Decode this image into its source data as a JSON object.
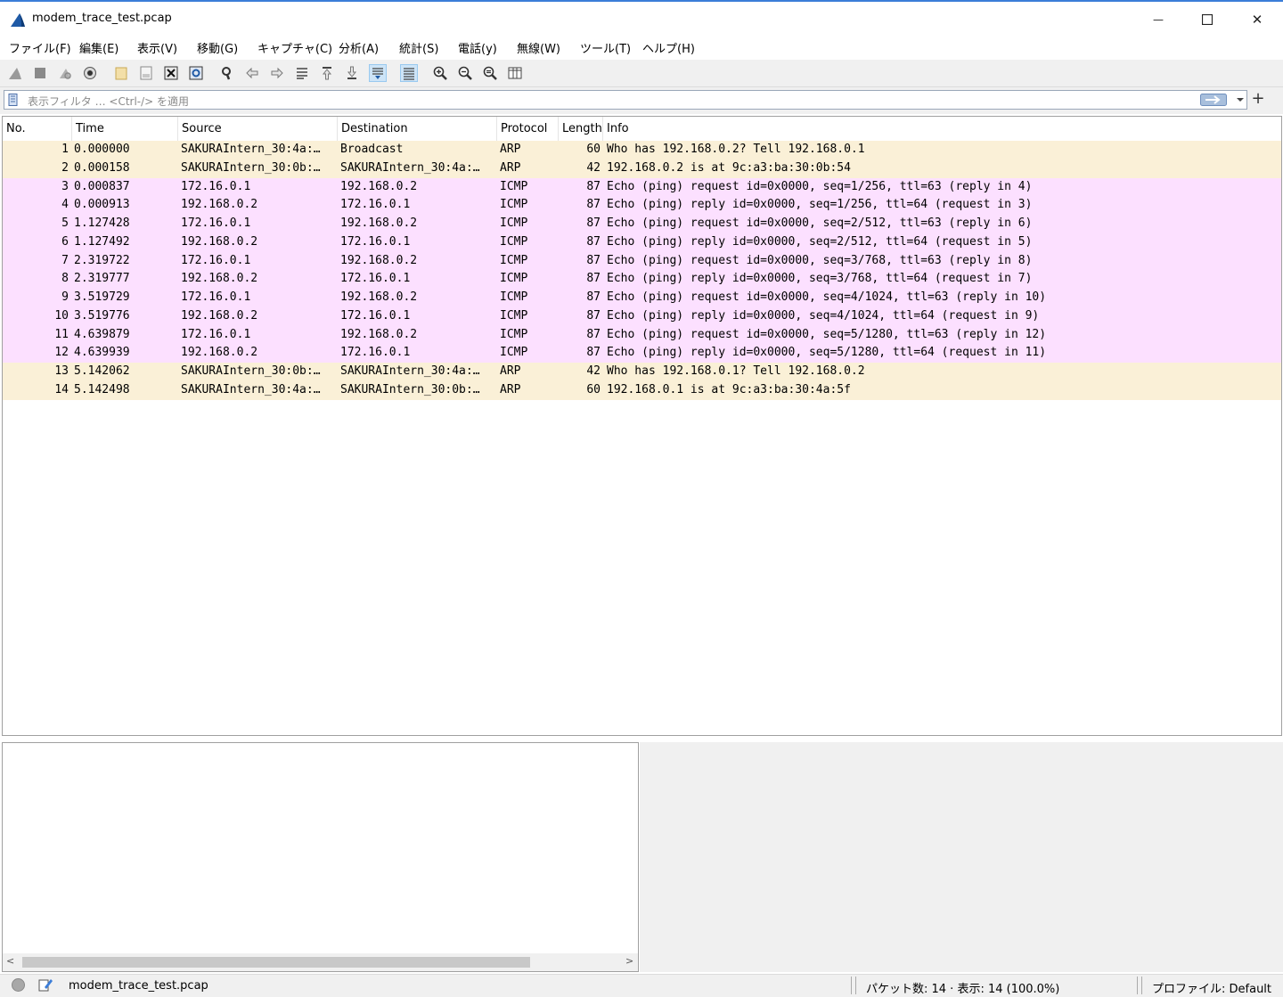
{
  "window": {
    "title": "modem_trace_test.pcap",
    "min_glyph": "—",
    "close_glyph": "✕"
  },
  "menu": {
    "items": [
      {
        "label": "ファイル(F)"
      },
      {
        "label": "編集(E)"
      },
      {
        "label": "表示(V)"
      },
      {
        "label": "移動(G)"
      },
      {
        "label": "キャプチャ(C)"
      },
      {
        "label": "分析(A)"
      },
      {
        "label": "統計(S)"
      },
      {
        "label": "電話(y)"
      },
      {
        "label": "無線(W)"
      },
      {
        "label": "ツール(T)"
      },
      {
        "label": "ヘルプ(H)"
      }
    ]
  },
  "toolbar": {
    "icons": [
      "shark-fin-start-icon",
      "stop-square-icon",
      "restart-icon",
      "capture-options-icon",
      "open-folder-icon",
      "save-file-icon",
      "close-file-icon",
      "reload-file-icon",
      "find-packet-icon",
      "go-back-icon",
      "go-forward-icon",
      "go-to-packet-icon",
      "first-packet-icon",
      "last-packet-icon",
      "autoscroll-icon",
      "colorize-icon",
      "zoom-in-icon",
      "zoom-out-icon",
      "zoom-normal-icon",
      "resize-columns-icon"
    ]
  },
  "filter": {
    "placeholder": "表示フィルタ … <Ctrl-/> を適用",
    "add_label": "+"
  },
  "packet_list": {
    "columns": [
      {
        "label": "No."
      },
      {
        "label": "Time"
      },
      {
        "label": "Source"
      },
      {
        "label": "Destination"
      },
      {
        "label": "Protocol"
      },
      {
        "label": "Length"
      },
      {
        "label": "Info"
      }
    ],
    "colors": {
      "arp": "#faf0d7",
      "icmp": "#fce0ff"
    },
    "rows": [
      {
        "no": "1",
        "time": "0.000000",
        "source": "SAKURAIntern_30:4a:…",
        "destination": "Broadcast",
        "protocol": "ARP",
        "length": "60",
        "info": "Who has 192.168.0.2? Tell 192.168.0.1"
      },
      {
        "no": "2",
        "time": "0.000158",
        "source": "SAKURAIntern_30:0b:…",
        "destination": "SAKURAIntern_30:4a:…",
        "protocol": "ARP",
        "length": "42",
        "info": "192.168.0.2 is at 9c:a3:ba:30:0b:54"
      },
      {
        "no": "3",
        "time": "0.000837",
        "source": "172.16.0.1",
        "destination": "192.168.0.2",
        "protocol": "ICMP",
        "length": "87",
        "info": "Echo (ping) request  id=0x0000, seq=1/256, ttl=63 (reply in 4)"
      },
      {
        "no": "4",
        "time": "0.000913",
        "source": "192.168.0.2",
        "destination": "172.16.0.1",
        "protocol": "ICMP",
        "length": "87",
        "info": "Echo (ping) reply    id=0x0000, seq=1/256, ttl=64 (request in 3)"
      },
      {
        "no": "5",
        "time": "1.127428",
        "source": "172.16.0.1",
        "destination": "192.168.0.2",
        "protocol": "ICMP",
        "length": "87",
        "info": "Echo (ping) request  id=0x0000, seq=2/512, ttl=63 (reply in 6)"
      },
      {
        "no": "6",
        "time": "1.127492",
        "source": "192.168.0.2",
        "destination": "172.16.0.1",
        "protocol": "ICMP",
        "length": "87",
        "info": "Echo (ping) reply    id=0x0000, seq=2/512, ttl=64 (request in 5)"
      },
      {
        "no": "7",
        "time": "2.319722",
        "source": "172.16.0.1",
        "destination": "192.168.0.2",
        "protocol": "ICMP",
        "length": "87",
        "info": "Echo (ping) request  id=0x0000, seq=3/768, ttl=63 (reply in 8)"
      },
      {
        "no": "8",
        "time": "2.319777",
        "source": "192.168.0.2",
        "destination": "172.16.0.1",
        "protocol": "ICMP",
        "length": "87",
        "info": "Echo (ping) reply    id=0x0000, seq=3/768, ttl=64 (request in 7)"
      },
      {
        "no": "9",
        "time": "3.519729",
        "source": "172.16.0.1",
        "destination": "192.168.0.2",
        "protocol": "ICMP",
        "length": "87",
        "info": "Echo (ping) request  id=0x0000, seq=4/1024, ttl=63 (reply in 10)"
      },
      {
        "no": "10",
        "time": "3.519776",
        "source": "192.168.0.2",
        "destination": "172.16.0.1",
        "protocol": "ICMP",
        "length": "87",
        "info": "Echo (ping) reply    id=0x0000, seq=4/1024, ttl=64 (request in 9)"
      },
      {
        "no": "11",
        "time": "4.639879",
        "source": "172.16.0.1",
        "destination": "192.168.0.2",
        "protocol": "ICMP",
        "length": "87",
        "info": "Echo (ping) request  id=0x0000, seq=5/1280, ttl=63 (reply in 12)"
      },
      {
        "no": "12",
        "time": "4.639939",
        "source": "192.168.0.2",
        "destination": "172.16.0.1",
        "protocol": "ICMP",
        "length": "87",
        "info": "Echo (ping) reply    id=0x0000, seq=5/1280, ttl=64 (request in 11)"
      },
      {
        "no": "13",
        "time": "5.142062",
        "source": "SAKURAIntern_30:0b:…",
        "destination": "SAKURAIntern_30:4a:…",
        "protocol": "ARP",
        "length": "42",
        "info": "Who has 192.168.0.1? Tell 192.168.0.2"
      },
      {
        "no": "14",
        "time": "5.142498",
        "source": "SAKURAIntern_30:4a:…",
        "destination": "SAKURAIntern_30:0b:…",
        "protocol": "ARP",
        "length": "60",
        "info": "192.168.0.1 is at 9c:a3:ba:30:4a:5f"
      }
    ]
  },
  "details": {
    "scroll_left": "<",
    "scroll_right": ">"
  },
  "status": {
    "file": "modem_trace_test.pcap",
    "packets": "パケット数: 14 · 表示: 14 (100.0%)",
    "profile": "プロファイル: Default"
  }
}
